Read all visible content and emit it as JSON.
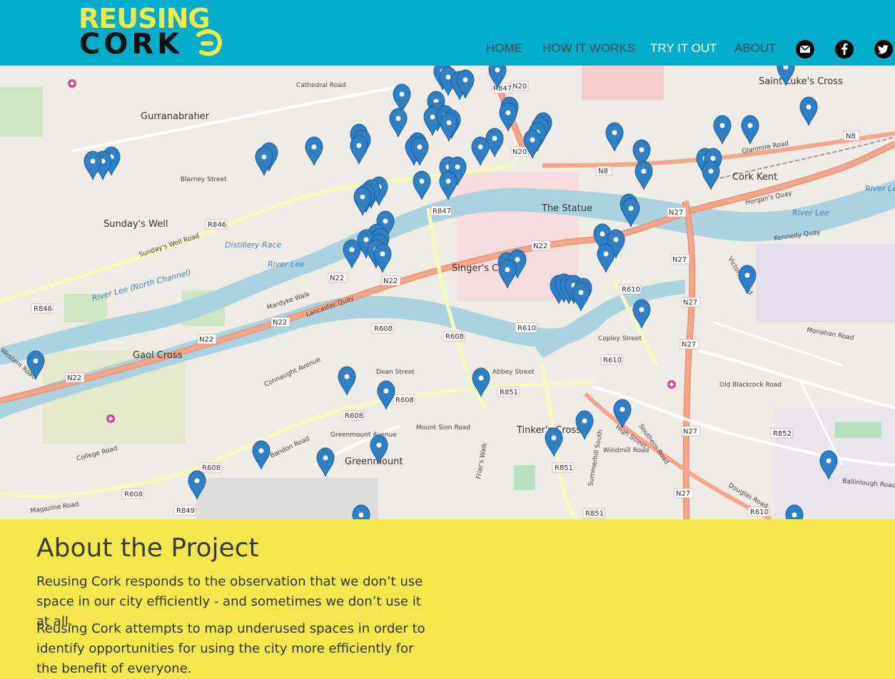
{
  "header": {
    "logo_line1": "REUSING",
    "logo_line2": "CORK",
    "nav": [
      {
        "label": "HOME",
        "active": false
      },
      {
        "label": "HOW IT WORKS",
        "active": false
      },
      {
        "label": "TRY IT OUT",
        "active": true
      },
      {
        "label": "ABOUT",
        "active": false
      }
    ],
    "social": [
      {
        "icon": "email-icon"
      },
      {
        "icon": "facebook-icon"
      },
      {
        "icon": "twitter-icon"
      }
    ]
  },
  "map": {
    "places": [
      "Gurranabraher",
      "Sunday's Well",
      "Greenmount",
      "The Statue",
      "Cork Kent",
      "Singer's Corner",
      "Gaol Cross",
      "Tinker's Cross",
      "Saint Luke's Cross"
    ],
    "water_labels": [
      "River Lee (North Channel)",
      "River Lee",
      "Distillery Race"
    ],
    "road_labels": [
      "Cathedral Road",
      "Blarney Street",
      "Sunday's Well Road",
      "Mardyke Walk",
      "Lancaster Quay",
      "College Road",
      "Magazine Road",
      "Glanmire Road",
      "Horgan's Quay",
      "Kennedy Quay",
      "Monahan Road",
      "Douglas Road",
      "Southern Road",
      "Ballinlough Road",
      "Old Blackrock Road",
      "Victoria Road",
      "Copley Street",
      "Abbey Street",
      "Dean Street",
      "Bandon Road",
      "Greenmount Avenue",
      "Mount Sion Road",
      "Friar's Walk",
      "Windmill Road",
      "High Street",
      "Summerhill South",
      "Connaught Avenue",
      "Western Road"
    ],
    "shields": [
      "N20",
      "N8",
      "N27",
      "N22",
      "R847",
      "R846",
      "R608",
      "R610",
      "R851",
      "R852",
      "R849"
    ],
    "marker_color": "#2e7fc4"
  },
  "about": {
    "title": "About the Project",
    "p1": "Reusing Cork responds to the observation that we don’t use space in our city efficiently - and sometimes we don’t use it at all.",
    "p2": "Reusing Cork attempts to map underused spaces in order to identify opportunities for using the city more efficiently for the benefit of everyone."
  }
}
